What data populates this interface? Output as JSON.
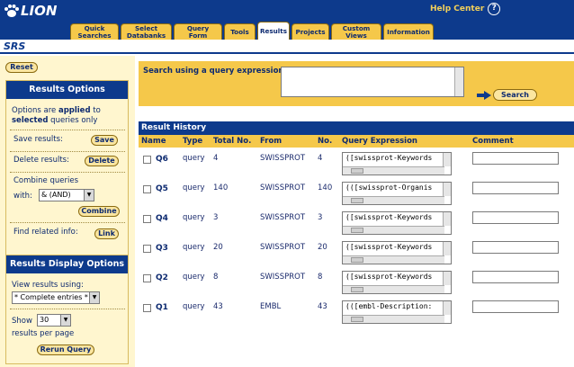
{
  "header": {
    "logo_text": "LION",
    "help_label": "Help Center",
    "help_icon": "?",
    "tabs": [
      {
        "label": "Quick\nSearches",
        "active": false
      },
      {
        "label": "Select\nDatabanks",
        "active": false
      },
      {
        "label": "Query\nForm",
        "active": false
      },
      {
        "label": "Tools",
        "active": false
      },
      {
        "label": "Results",
        "active": true
      },
      {
        "label": "Projects",
        "active": false
      },
      {
        "label": "Custom\nViews",
        "active": false
      },
      {
        "label": "Information",
        "active": false
      }
    ]
  },
  "app_title": "SRS",
  "sidebar": {
    "reset_label": "Reset",
    "results_options": {
      "title": "Results Options",
      "intro_1": "Options are ",
      "intro_bold_1": "applied",
      "intro_2": " to",
      "intro_bold_2": "selected",
      "intro_3": " queries only",
      "save_label": "Save results:",
      "save_btn": "Save",
      "delete_label": "Delete results:",
      "delete_btn": "Delete",
      "combine_label": "Combine queries",
      "with_label": "with:",
      "combine_value": "& (AND)",
      "combine_btn": "Combine",
      "related_label": "Find related info:",
      "link_btn": "Link"
    },
    "display_options": {
      "title": "Results Display Options",
      "view_label": "View results using:",
      "view_value": "* Complete entries *",
      "show_label": "Show",
      "show_value": "30",
      "per_page_label": "results per page",
      "rerun_btn": "Rerun Query"
    }
  },
  "search": {
    "label": "Search using a query expression:",
    "value": "",
    "button": "Search"
  },
  "history": {
    "title": "Result History",
    "columns": [
      "Name",
      "Type",
      "Total No.",
      "From",
      "No.",
      "Query Expression",
      "Comment"
    ],
    "rows": [
      {
        "name": "Q6",
        "type": "query",
        "total": "4",
        "from": "SWISSPROT",
        "no": "4",
        "expr": "([swissprot-Keywords",
        "comment": ""
      },
      {
        "name": "Q5",
        "type": "query",
        "total": "140",
        "from": "SWISSPROT",
        "no": "140",
        "expr": "(([swissprot-Organis",
        "comment": ""
      },
      {
        "name": "Q4",
        "type": "query",
        "total": "3",
        "from": "SWISSPROT",
        "no": "3",
        "expr": "([swissprot-Keywords",
        "comment": ""
      },
      {
        "name": "Q3",
        "type": "query",
        "total": "20",
        "from": "SWISSPROT",
        "no": "20",
        "expr": "([swissprot-Keywords",
        "comment": ""
      },
      {
        "name": "Q2",
        "type": "query",
        "total": "8",
        "from": "SWISSPROT",
        "no": "8",
        "expr": "([swissprot-Keywords",
        "comment": ""
      },
      {
        "name": "Q1",
        "type": "query",
        "total": "43",
        "from": "EMBL",
        "no": "43",
        "expr": "(([embl-Description:",
        "comment": ""
      }
    ]
  },
  "colors": {
    "navy": "#0d3a8c",
    "gold": "#f5c84a",
    "cream": "#fff6cf",
    "help_gold": "#f2d05a"
  }
}
